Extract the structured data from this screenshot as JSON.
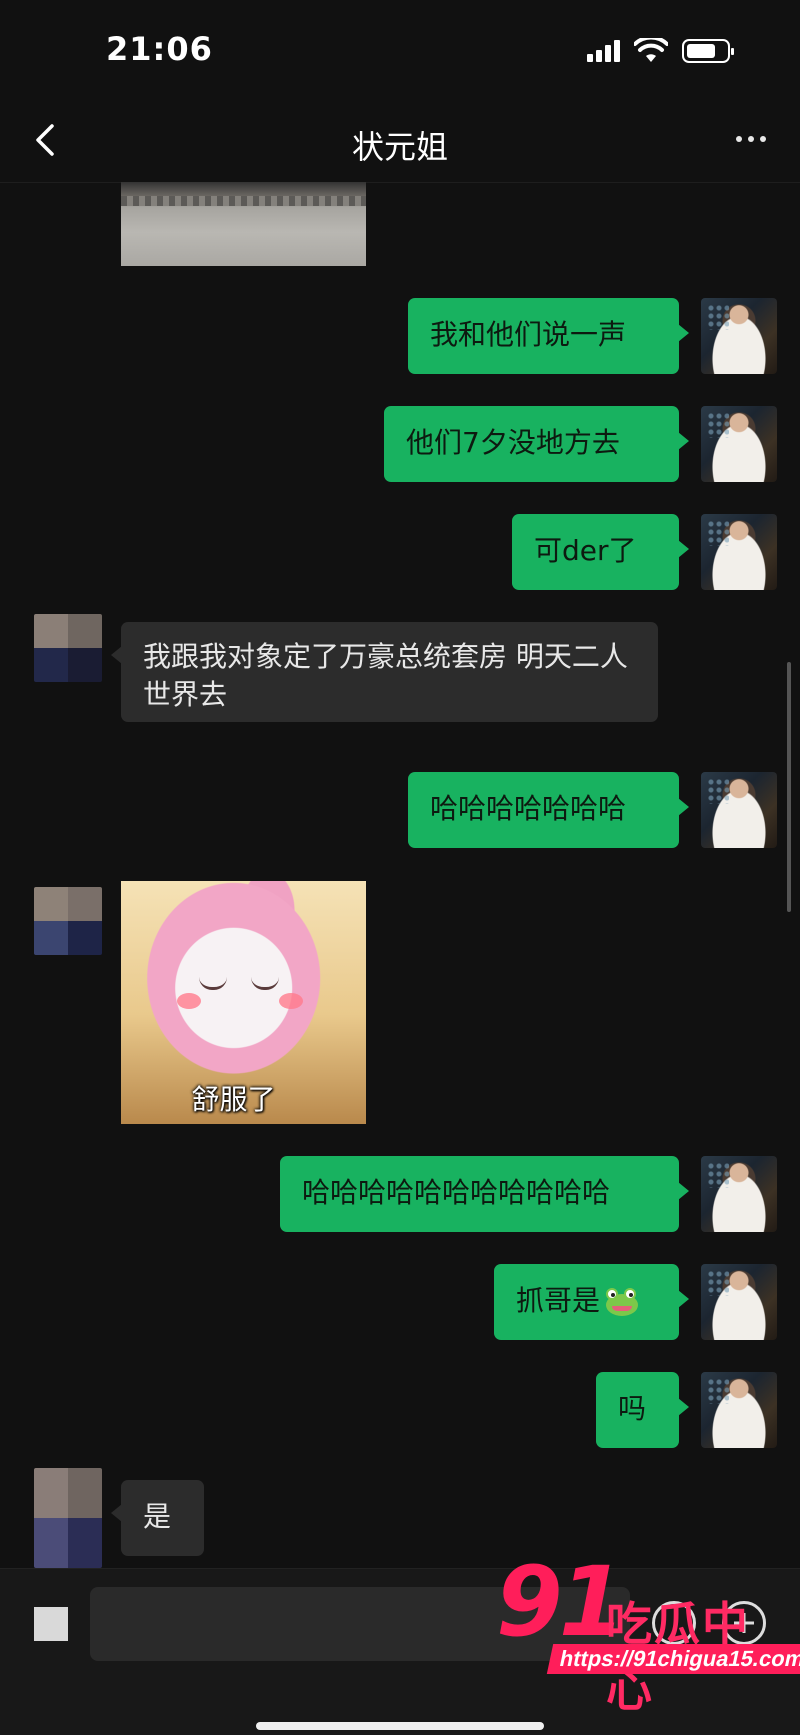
{
  "status_bar": {
    "time": "21:06"
  },
  "nav": {
    "title": "状元姐"
  },
  "messages": [
    {
      "sender": "self",
      "text": "我和他们说一声"
    },
    {
      "sender": "self",
      "text": "他们7夕没地方去"
    },
    {
      "sender": "self",
      "text": "可der了"
    },
    {
      "sender": "other",
      "text": "我跟我对象定了万豪总统套房 明天二人世界去"
    },
    {
      "sender": "self",
      "text": "哈哈哈哈哈哈哈"
    },
    {
      "sender": "other",
      "type": "sticker",
      "caption": "舒服了"
    },
    {
      "sender": "self",
      "text": "哈哈哈哈哈哈哈哈哈哈哈"
    },
    {
      "sender": "self",
      "text": "抓哥是",
      "emoji": "frog-emoji"
    },
    {
      "sender": "self",
      "text": "吗"
    },
    {
      "sender": "other",
      "text": "是"
    }
  ],
  "watermark": {
    "number": "91",
    "text": "吃瓜中心",
    "url": "https://91chigua15.com"
  },
  "colors": {
    "self_bubble": "#18b260",
    "other_bubble": "#2c2c2c",
    "background": "#111111",
    "watermark": "#ff1e5a"
  }
}
